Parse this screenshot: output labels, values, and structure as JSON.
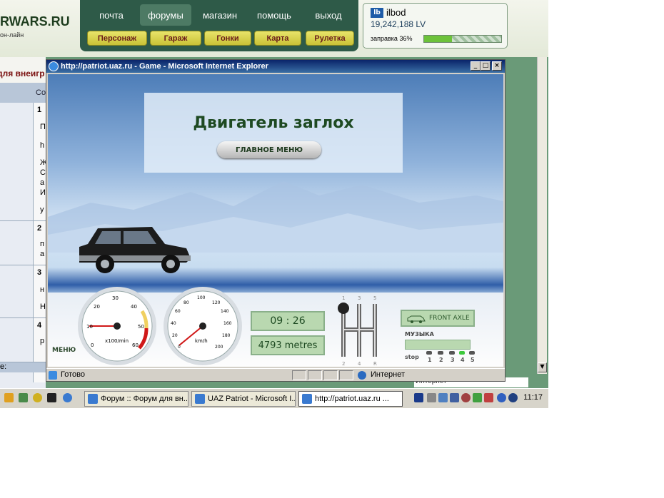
{
  "site": {
    "logo_text": "RWARS.RU",
    "logo_sub": "он-лайн",
    "nav_top": [
      "почта",
      "форумы",
      "магазин",
      "помощь",
      "выход"
    ],
    "nav_buttons": [
      "Персонаж",
      "Гараж",
      "Гонки",
      "Карта",
      "Рулетка"
    ],
    "user": {
      "icon": "lb",
      "name": "ilbod",
      "balance": "19,242,188 LV",
      "fuel_label": "заправка 36%",
      "fuel_percent": 36
    },
    "left_fragment": "для внеигр",
    "left_col_header": "Co",
    "left_numbers": [
      "1",
      "2",
      "3",
      "4"
    ],
    "left_letters": [
      "П",
      "h",
      "Ж",
      "С",
      "а",
      "И",
      "у",
      "п",
      "а",
      "н",
      "Н",
      "р"
    ],
    "left_footer": "е:"
  },
  "ie": {
    "title": "http://patriot.uaz.ru - Game - Microsoft Internet Explorer",
    "status_text": "Готово",
    "zone": "Интернет"
  },
  "game": {
    "message": "Двигатель заглох",
    "main_menu_label": "ГЛАВНОЕ МЕНЮ",
    "tacho": {
      "label": "x100/min",
      "ticks": [
        "0",
        "10",
        "20",
        "30",
        "40",
        "50",
        "60"
      ]
    },
    "speedo": {
      "label": "km/h",
      "ticks": [
        "0",
        "20",
        "40",
        "60",
        "80",
        "100",
        "120",
        "140",
        "160",
        "180",
        "200"
      ]
    },
    "time": "09 : 26",
    "distance": "4793 metres",
    "gears": {
      "top": [
        "1",
        "3",
        "5"
      ],
      "bottom": [
        "2",
        "4",
        "R"
      ]
    },
    "front_axle": "FRONT AXLE",
    "music_label": "МУЗЫКА",
    "music_stop": "stop",
    "music_levels": [
      "1",
      "2",
      "3",
      "4",
      "5"
    ],
    "menu_small": "МЕНЮ"
  },
  "taskbar": {
    "items": [
      "Форум :: Форум для вн...",
      "UAZ Patriot - Microsoft I...",
      "http://patriot.uaz.ru ..."
    ],
    "background_zone": "Интернет",
    "clock": "11:17"
  }
}
